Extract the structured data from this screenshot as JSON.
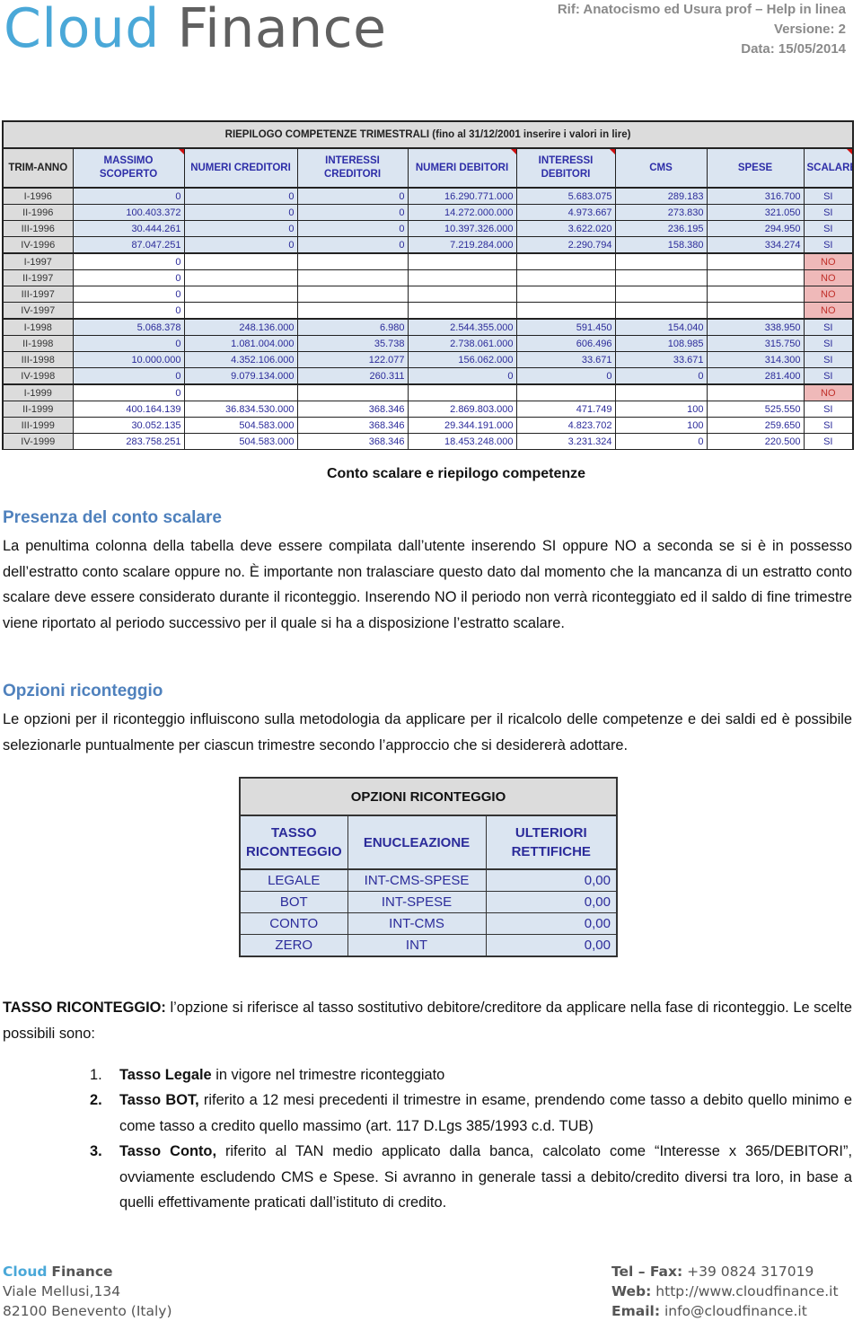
{
  "header": {
    "logo_part1": "Cloud",
    "logo_part2": "Finance",
    "ref": "Rif: Anatocismo ed Usura prof – Help in linea",
    "version": "Versione: 2",
    "date": "Data: 15/05/2014"
  },
  "summary_table": {
    "title": "RIEPILOGO COMPETENZE TRIMESTRALI (fino al 31/12/2001 inserire i valori in lire)",
    "columns": [
      "TRIM-ANNO",
      "MASSIMO SCOPERTO",
      "NUMERI CREDITORI",
      "INTERESSI CREDITORI",
      "NUMERI DEBITORI",
      "INTERESSI DEBITORI",
      "CMS",
      "SPESE",
      "SCALARE"
    ],
    "rows": [
      {
        "period": "I-1996",
        "values": [
          "0",
          "0",
          "0",
          "16.290.771.000",
          "5.683.075",
          "289.183",
          "316.700"
        ],
        "scalare": "SI"
      },
      {
        "period": "II-1996",
        "values": [
          "100.403.372",
          "0",
          "0",
          "14.272.000.000",
          "4.973.667",
          "273.830",
          "321.050"
        ],
        "scalare": "SI"
      },
      {
        "period": "III-1996",
        "values": [
          "30.444.261",
          "0",
          "0",
          "10.397.326.000",
          "3.622.020",
          "236.195",
          "294.950"
        ],
        "scalare": "SI"
      },
      {
        "period": "IV-1996",
        "values": [
          "87.047.251",
          "0",
          "0",
          "7.219.284.000",
          "2.290.794",
          "158.380",
          "334.274"
        ],
        "scalare": "SI"
      },
      {
        "period": "I-1997",
        "values": [
          "0",
          "",
          "",
          "",
          "",
          "",
          ""
        ],
        "scalare": "NO"
      },
      {
        "period": "II-1997",
        "values": [
          "0",
          "",
          "",
          "",
          "",
          "",
          ""
        ],
        "scalare": "NO"
      },
      {
        "period": "III-1997",
        "values": [
          "0",
          "",
          "",
          "",
          "",
          "",
          ""
        ],
        "scalare": "NO"
      },
      {
        "period": "IV-1997",
        "values": [
          "0",
          "",
          "",
          "",
          "",
          "",
          ""
        ],
        "scalare": "NO"
      },
      {
        "period": "I-1998",
        "values": [
          "5.068.378",
          "248.136.000",
          "6.980",
          "2.544.355.000",
          "591.450",
          "154.040",
          "338.950"
        ],
        "scalare": "SI"
      },
      {
        "period": "II-1998",
        "values": [
          "0",
          "1.081.004.000",
          "35.738",
          "2.738.061.000",
          "606.496",
          "108.985",
          "315.750"
        ],
        "scalare": "SI"
      },
      {
        "period": "III-1998",
        "values": [
          "10.000.000",
          "4.352.106.000",
          "122.077",
          "156.062.000",
          "33.671",
          "33.671",
          "314.300"
        ],
        "scalare": "SI"
      },
      {
        "period": "IV-1998",
        "values": [
          "0",
          "9.079.134.000",
          "260.311",
          "0",
          "0",
          "0",
          "281.400"
        ],
        "scalare": "SI"
      },
      {
        "period": "I-1999",
        "values": [
          "0",
          "",
          "",
          "",
          "",
          "",
          ""
        ],
        "scalare": "NO"
      },
      {
        "period": "II-1999",
        "values": [
          "400.164.139",
          "36.834.530.000",
          "368.346",
          "2.869.803.000",
          "471.749",
          "100",
          "525.550"
        ],
        "scalare": "SI"
      },
      {
        "period": "III-1999",
        "values": [
          "30.052.135",
          "504.583.000",
          "368.346",
          "29.344.191.000",
          "4.823.702",
          "100",
          "259.650"
        ],
        "scalare": "SI"
      },
      {
        "period": "IV-1999",
        "values": [
          "283.758.251",
          "504.583.000",
          "368.346",
          "18.453.248.000",
          "3.231.324",
          "0",
          "220.500"
        ],
        "scalare": "SI"
      }
    ]
  },
  "caption": "Conto scalare e riepilogo competenze",
  "section1": {
    "heading": "Presenza del conto scalare",
    "text": "La penultima colonna della tabella deve essere compilata dall’utente inserendo SI oppure NO a seconda se si è in possesso dell’estratto conto scalare oppure no. È importante non tralasciare questo dato dal momento che la mancanza di un estratto conto scalare deve essere considerato durante il riconteggio. Inserendo NO il periodo non verrà riconteggiato ed il saldo di fine trimestre viene riportato al periodo successivo per il quale si ha a disposizione l’estratto scalare."
  },
  "section2": {
    "heading": "Opzioni riconteggio",
    "text": "Le opzioni per il riconteggio influiscono sulla metodologia da applicare per il ricalcolo delle competenze e dei saldi ed è possibile selezionarle puntualmente per ciascun trimestre secondo l’approccio che si desidererà adottare."
  },
  "options_table": {
    "title": "OPZIONI RICONTEGGIO",
    "columns": [
      "TASSO RICONTEGGIO",
      "ENUCLEAZIONE",
      "ULTERIORI RETTIFICHE"
    ],
    "rows": [
      [
        "LEGALE",
        "INT-CMS-SPESE",
        "0,00"
      ],
      [
        "BOT",
        "INT-SPESE",
        "0,00"
      ],
      [
        "CONTO",
        "INT-CMS",
        "0,00"
      ],
      [
        "ZERO",
        "INT",
        "0,00"
      ]
    ]
  },
  "section3": {
    "lead_bold": "TASSO RICONTEGGIO:",
    "lead_text": " l’opzione si riferisce al tasso sostitutivo debitore/creditore da applicare nella fase di riconteggio. Le scelte possibili sono:",
    "items": [
      {
        "num": "1.",
        "bold": "Tasso Legale",
        "text": " in vigore nel trimestre riconteggiato"
      },
      {
        "num": "2.",
        "bold": "Tasso BOT,",
        "text": " riferito a 12 mesi precedenti il trimestre in esame, prendendo come tasso a debito quello minimo e come tasso a credito quello massimo (art. 117 D.Lgs 385/1993 c.d. TUB)"
      },
      {
        "num": "3.",
        "bold": "Tasso Conto,",
        "text": " riferito al TAN medio applicato dalla banca, calcolato come “Interesse x 365/DEBITORI”, ovviamente escludendo CMS e Spese. Si avranno in generale tassi a debito/credito diversi tra loro, in base a quelli effettivamente praticati dall’istituto di credito."
      }
    ]
  },
  "footer": {
    "company_part1": "Cloud",
    "company_part2": "Finance",
    "address1": "Viale Mellusi,134",
    "address2": "82100 Benevento (Italy)",
    "tel_label": "Tel – Fax:",
    "tel": " +39 0824 317019",
    "web_label": "Web:",
    "web": " http://www.cloudfinance.it",
    "email_label": "Email:",
    "email": " info@cloudfinance.it"
  }
}
